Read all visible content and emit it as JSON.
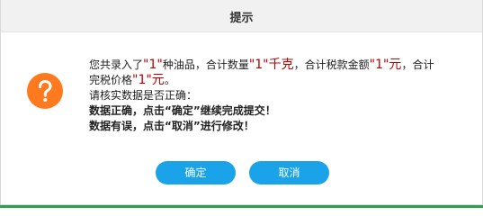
{
  "dialog": {
    "title": "提示",
    "icon": "question-icon",
    "icon_color": "#ff7a1f",
    "message": {
      "line1": {
        "t1": "您共录入了",
        "v1": "\"1\"",
        "t2": "种油品，合计数量",
        "v2": "\"1\"千克",
        "t3": "，合计税款金额",
        "v3": "\"1\"元",
        "t4": "，合计"
      },
      "line2": {
        "t1": "完税价格",
        "v1": "\"1\"元",
        "t2": "。"
      },
      "line3": "请核实数据是否正确：",
      "line4": "数据正确，点击“确定”继续完成提交！",
      "line5": "数据有误，点击“取消”进行修改！"
    },
    "buttons": {
      "ok": "确定",
      "cancel": "取消"
    },
    "accent_color": "#1aa3e8",
    "value_color": "#c00000"
  }
}
